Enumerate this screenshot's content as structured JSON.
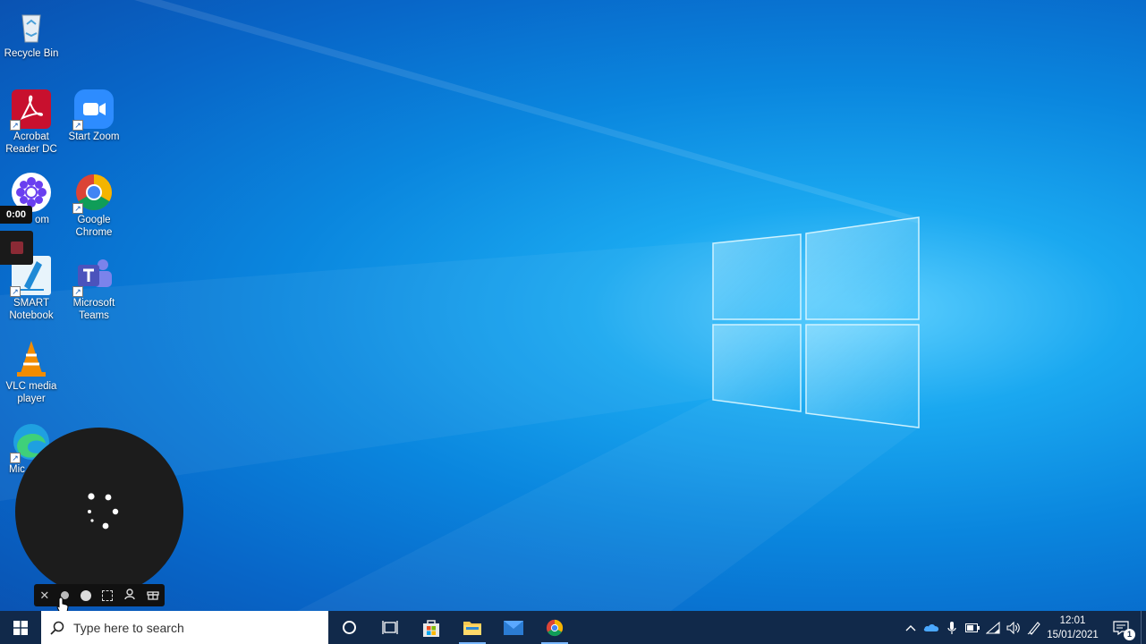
{
  "desktop": {
    "icons": [
      {
        "label": "Recycle Bin"
      },
      {
        "label": "Acrobat Reader DC"
      },
      {
        "label": "Start Zoom"
      },
      {
        "label": "om"
      },
      {
        "label": "Google Chrome"
      },
      {
        "label": "SMART Notebook"
      },
      {
        "label": "Microsoft Teams"
      },
      {
        "label": "VLC media player"
      },
      {
        "label": "Mic"
      }
    ]
  },
  "recorder": {
    "timer": "0:00",
    "toolbar_icons": [
      "close-icon",
      "small-dot-icon",
      "record-dot-icon",
      "fullscreen-icon",
      "person-icon",
      "gift-icon"
    ]
  },
  "taskbar": {
    "search_placeholder": "Type here to search",
    "pinned": [
      "start-icon",
      "cortana-icon",
      "task-view-icon",
      "store-icon",
      "file-explorer-icon",
      "mail-icon",
      "chrome-icon"
    ],
    "tray": [
      "chevron-up-icon",
      "onedrive-icon",
      "microphone-icon",
      "battery-icon",
      "wifi-icon",
      "volume-icon",
      "pen-icon"
    ],
    "clock_time": "12:01",
    "clock_date": "15/01/2021",
    "notification_count": "1"
  },
  "colors": {
    "taskbar": "#11294a",
    "accent": "#0a86de",
    "recorder_bg": "#1c1c1c"
  }
}
